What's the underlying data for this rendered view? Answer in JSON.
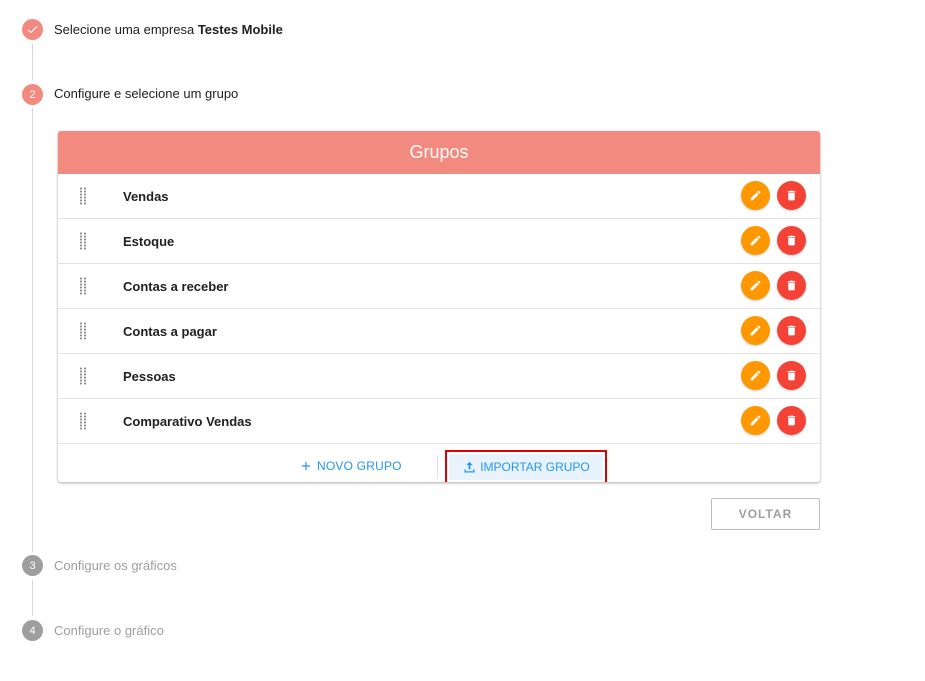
{
  "stepper": {
    "steps": [
      {
        "number": "",
        "label_prefix": "Selecione uma empresa",
        "label_bold": "Testes Mobile",
        "state": "done"
      },
      {
        "number": "2",
        "label_prefix": "Configure e selecione um grupo",
        "label_bold": "",
        "state": "active"
      },
      {
        "number": "3",
        "label_prefix": "Configure os gráficos",
        "label_bold": "",
        "state": "pending"
      },
      {
        "number": "4",
        "label_prefix": "Configure o gráfico",
        "label_bold": "",
        "state": "pending"
      }
    ]
  },
  "groups_card": {
    "title": "Grupos",
    "rows": [
      {
        "label": "Vendas"
      },
      {
        "label": "Estoque"
      },
      {
        "label": "Contas a receber"
      },
      {
        "label": "Contas a pagar"
      },
      {
        "label": "Pessoas"
      },
      {
        "label": "Comparativo Vendas"
      }
    ],
    "new_group_label": "NOVO GRUPO",
    "import_group_label": "IMPORTAR GRUPO"
  },
  "back_button_label": "VOLTAR",
  "colors": {
    "accent": "#f28a7f",
    "edit": "#ff9800",
    "delete": "#f44336",
    "link": "#2196f3",
    "highlight_border": "#e00000"
  },
  "icons": {
    "check": "check-icon",
    "drag": "drag-handle-icon",
    "edit": "pencil-icon",
    "delete": "trash-icon",
    "add": "plus-icon",
    "upload": "upload-icon"
  }
}
